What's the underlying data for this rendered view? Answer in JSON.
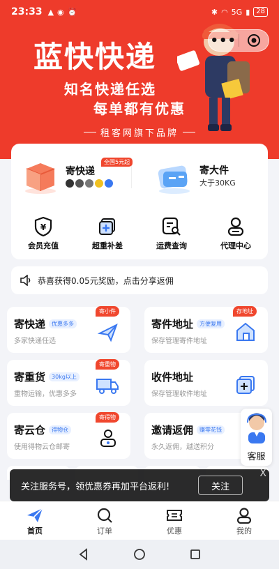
{
  "status_bar": {
    "time": "23:33",
    "battery": "28",
    "signal": "5G"
  },
  "banner": {
    "title": "蓝快快递",
    "slogan_line1": "知名快递任选",
    "slogan_line2": "每单都有优惠",
    "brand_line": "租客网旗下品牌"
  },
  "capsule": {
    "more": "•••"
  },
  "send_card": {
    "express": {
      "name": "寄快递",
      "tag": "全国5元起"
    },
    "big": {
      "name": "寄大件",
      "sub": "大于30KG"
    },
    "quick": [
      {
        "label": "会员充值"
      },
      {
        "label": "超重补差"
      },
      {
        "label": "运费查询"
      },
      {
        "label": "代理中心"
      }
    ]
  },
  "notice": {
    "text": "恭喜获得0.05元奖励，点击分享返佣"
  },
  "grid": [
    {
      "title": "寄快递",
      "badge": "优惠多多",
      "sub": "多家快递任选",
      "tag": "寄小件"
    },
    {
      "title": "寄件地址",
      "badge": "方便复用",
      "sub": "保存管理寄件地址",
      "tag": "存地址"
    },
    {
      "title": "寄重货",
      "badge": "30kg以上",
      "sub": "重物运输，优惠多多",
      "tag": "寄重物"
    },
    {
      "title": "收件地址",
      "badge": "",
      "sub": "保存管理收件地址",
      "tag": ""
    },
    {
      "title": "寄云仓",
      "badge": "得物仓",
      "sub": "使用得物云仓邮寄",
      "tag": "寄得物"
    },
    {
      "title": "邀请返佣",
      "badge": "赚零花钱",
      "sub": "永久返佣，越送积分",
      "tag": ""
    }
  ],
  "toast": {
    "text": "关注服务号，领优惠券再加平台返利!",
    "follow": "关注",
    "close": "X"
  },
  "service": {
    "label": "客服"
  },
  "tabbar": [
    {
      "label": "首页"
    },
    {
      "label": "订单"
    },
    {
      "label": "优惠"
    },
    {
      "label": "我的"
    }
  ],
  "colors": {
    "brand_red": "#ee3b2b",
    "accent_blue": "#3a78f0",
    "tag_red": "#f0472e"
  }
}
